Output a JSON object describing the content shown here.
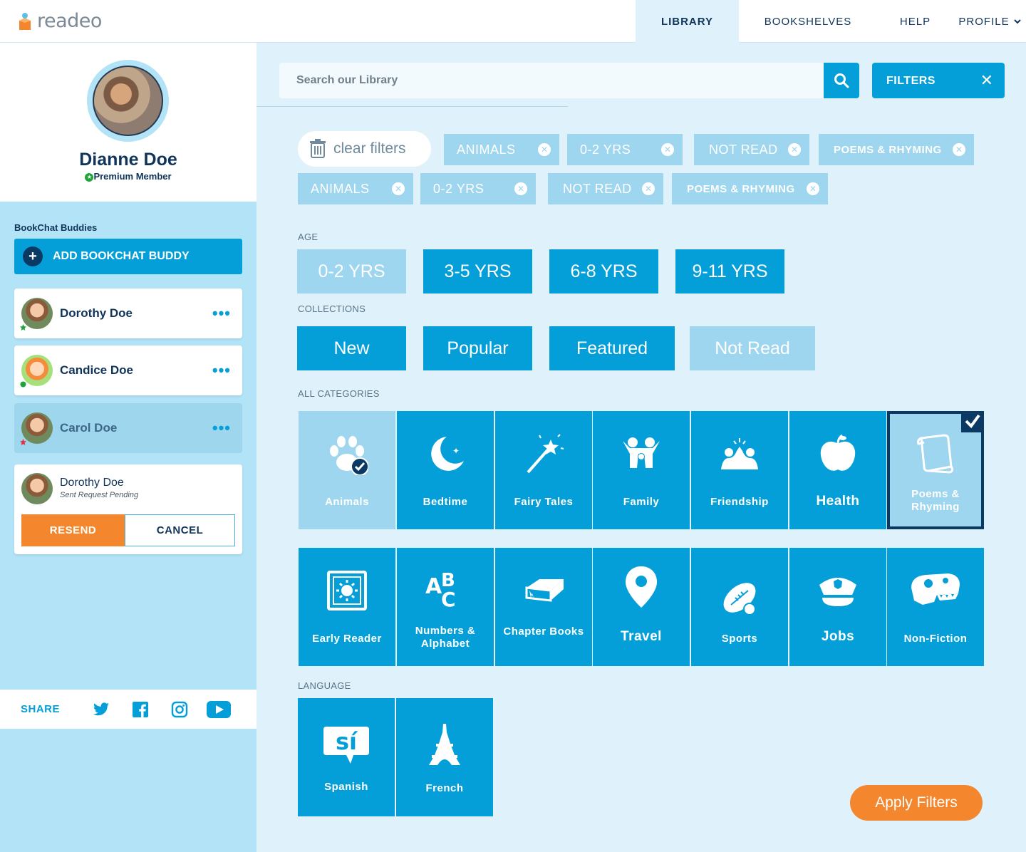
{
  "app": {
    "logo_text": "readeo"
  },
  "nav": {
    "library": "LIBRARY",
    "bookshelves": "BOOKSHELVES",
    "help": "HELP",
    "profile": "PROFILE"
  },
  "profile": {
    "name": "Dianne Doe",
    "membership": "Premium Member"
  },
  "buddies": {
    "title": "BookChat Buddies",
    "add_label": "ADD BOOKCHAT BUDDY",
    "items": [
      {
        "name": "Dorothy Doe",
        "more": "•••"
      },
      {
        "name": "Candice Doe",
        "more": "•••"
      },
      {
        "name": "Carol Doe",
        "more": "•••"
      }
    ],
    "pending": {
      "name": "Dorothy Doe",
      "status": "Sent Request Pending",
      "resend": "RESEND",
      "cancel": "CANCEL"
    }
  },
  "share": {
    "label": "SHARE"
  },
  "search": {
    "placeholder": "Search our Library"
  },
  "filters": {
    "label": "FILTERS",
    "close": "✕"
  },
  "active_filters": {
    "clear_label": "clear filters",
    "row1": [
      "ANIMALS",
      "0-2 YRS",
      "NOT READ",
      "POEMS & RHYMING"
    ],
    "row2": [
      "ANIMALS",
      "0-2 YRS",
      "NOT READ",
      "POEMS & RHYMING"
    ]
  },
  "age": {
    "label": "AGE",
    "options": [
      "0-2 YRS",
      "3-5 YRS",
      "6-8 YRS",
      "9-11 YRS"
    ]
  },
  "collections": {
    "label": "COLLECTIONS",
    "options": [
      "New",
      "Popular",
      "Featured",
      "Not Read"
    ]
  },
  "categories": {
    "label": "ALL CATEGORIES",
    "row1": [
      "Animals",
      "Bedtime",
      "Fairy Tales",
      "Family",
      "Friendship",
      "Health",
      "Poems & Rhyming"
    ],
    "row2": [
      "Early Reader",
      "Numbers & Alphabet",
      "Chapter Books",
      "Travel",
      "Sports",
      "Jobs",
      "Non-Fiction"
    ]
  },
  "language": {
    "label": "LANGUAGE",
    "options": [
      "Spanish",
      "French"
    ],
    "spanish_glyph": "sí"
  },
  "apply_label": "Apply Filters",
  "colors": {
    "accent": "#049fd9",
    "light": "#9fd6ef",
    "navy": "#0a3a63",
    "orange": "#f4862e",
    "bg": "#dff2fb"
  }
}
